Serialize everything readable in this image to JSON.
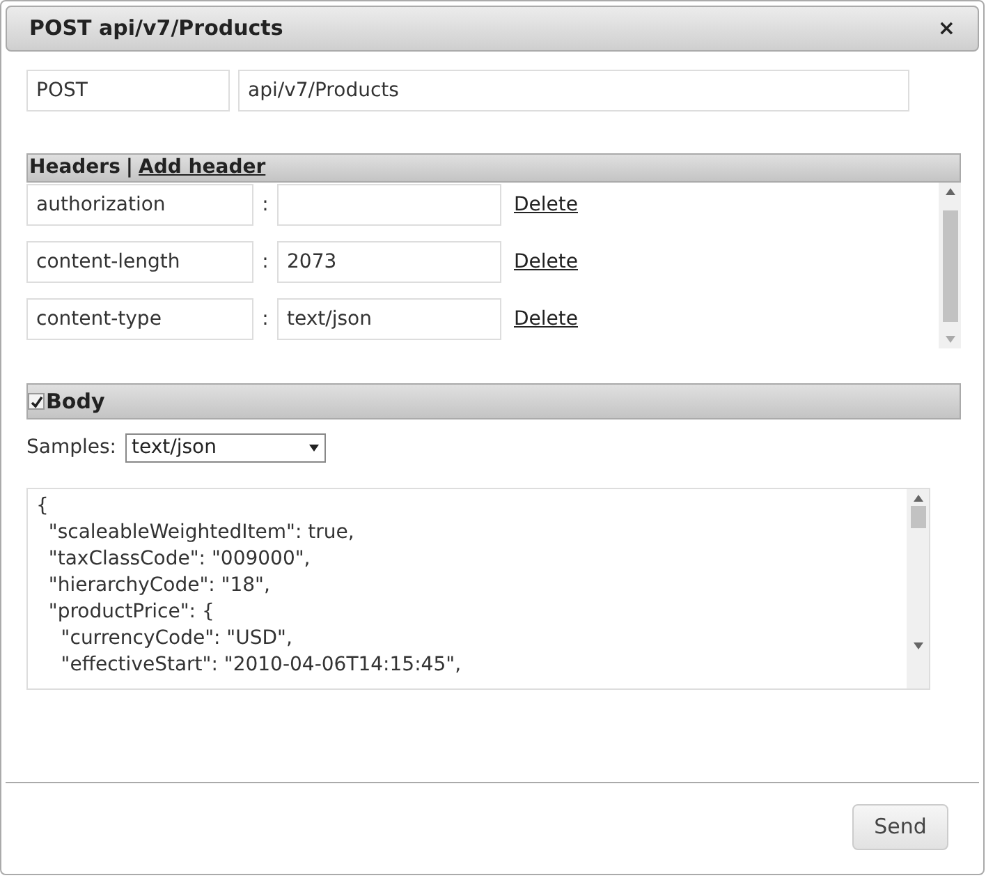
{
  "window": {
    "title": "POST api/v7/Products",
    "close": "×"
  },
  "request": {
    "method": "POST",
    "url": "api/v7/Products"
  },
  "headers": {
    "title": "Headers",
    "separator": "|",
    "add_link": "Add header",
    "rows": [
      {
        "name": "authorization",
        "separator": ":",
        "value": "",
        "action": "Delete"
      },
      {
        "name": "content-length",
        "separator": ":",
        "value": "2073",
        "action": "Delete"
      },
      {
        "name": "content-type",
        "separator": ":",
        "value": "text/json",
        "action": "Delete"
      }
    ]
  },
  "body": {
    "title": "Body",
    "checked": true,
    "samples_label": "Samples:",
    "samples_value": "text/json",
    "lines": [
      "{",
      "  \"scaleableWeightedItem\": true,",
      "  \"taxClassCode\": \"009000\",",
      "  \"hierarchyCode\": \"18\",",
      "  \"productPrice\": {",
      "    \"currencyCode\": \"USD\",",
      "    \"effectiveStart\": \"2010-04-06T14:15:45\","
    ]
  },
  "footer": {
    "button": "Send"
  }
}
